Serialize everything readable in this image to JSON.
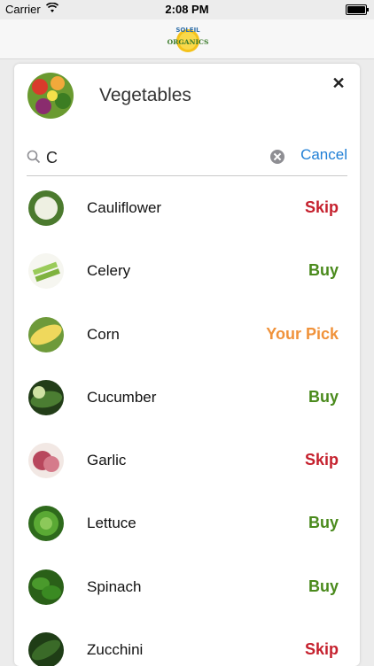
{
  "status_bar": {
    "carrier": "Carrier",
    "time": "2:08 PM"
  },
  "header": {
    "logo_top_text": "SOLEIL",
    "logo_bottom_text": "ORGANICS"
  },
  "category": {
    "title": "Vegetables",
    "close_label": "✕"
  },
  "search": {
    "value": "C",
    "placeholder": "",
    "cancel_label": "Cancel"
  },
  "colors": {
    "skip": "#c5202d",
    "buy": "#4a8a1c",
    "your_pick": "#f0923a",
    "cancel": "#1f7fd6"
  },
  "items": [
    {
      "name": "Cauliflower",
      "status": "Skip",
      "status_type": "skip",
      "thumb_color": "#e7ecd9"
    },
    {
      "name": "Celery",
      "status": "Buy",
      "status_type": "buy",
      "thumb_color": "#9acb5a"
    },
    {
      "name": "Corn",
      "status": "Your Pick",
      "status_type": "your_pick",
      "thumb_color": "#e8d25b"
    },
    {
      "name": "Cucumber",
      "status": "Buy",
      "status_type": "buy",
      "thumb_color": "#3f6b2a"
    },
    {
      "name": "Garlic",
      "status": "Skip",
      "status_type": "skip",
      "thumb_color": "#b7485c"
    },
    {
      "name": "Lettuce",
      "status": "Buy",
      "status_type": "buy",
      "thumb_color": "#4a9a2c"
    },
    {
      "name": "Spinach",
      "status": "Buy",
      "status_type": "buy",
      "thumb_color": "#3d8a24"
    },
    {
      "name": "Zucchini",
      "status": "Skip",
      "status_type": "skip",
      "thumb_color": "#2f5a22"
    }
  ]
}
